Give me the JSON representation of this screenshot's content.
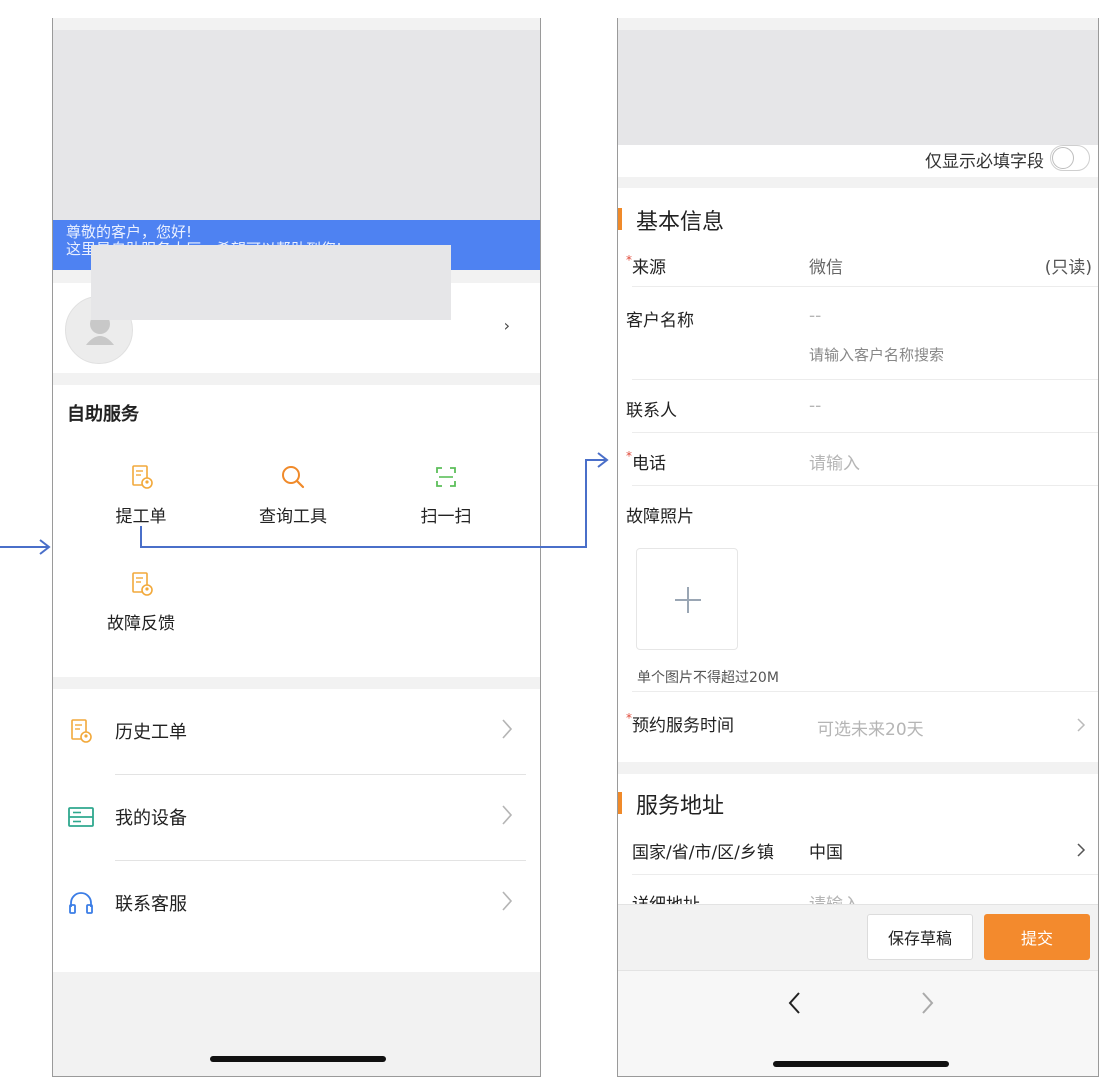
{
  "left_screen": {
    "banner": {
      "greeting": "尊敬的客户，您好!",
      "subtitle": "这里是自助服务大厅，希望可以帮助到您!"
    },
    "profile": {
      "chevron": "›"
    },
    "self_service": {
      "title": "自助服务",
      "items": [
        {
          "label": "提工单",
          "icon": "ticket-icon",
          "color": "#f2a93b"
        },
        {
          "label": "查询工具",
          "icon": "search-icon",
          "color": "#f08a2a"
        },
        {
          "label": "扫一扫",
          "icon": "scan-icon",
          "color": "#5cbf5a"
        },
        {
          "label": "故障反馈",
          "icon": "ticket-icon",
          "color": "#f2a93b"
        }
      ]
    },
    "list": [
      {
        "label": "历史工单",
        "icon": "history-ticket-icon",
        "color": "#f2a93b"
      },
      {
        "label": "我的设备",
        "icon": "device-icon",
        "color": "#2fa88e"
      },
      {
        "label": "联系客服",
        "icon": "headset-icon",
        "color": "#3b7de6"
      }
    ]
  },
  "right_screen": {
    "toggle_label": "仅显示必填字段",
    "basic_info": {
      "title": "基本信息",
      "source": {
        "label": "来源",
        "value": "微信",
        "note": "(只读)"
      },
      "customer_name": {
        "label": "客户名称",
        "value": "--",
        "placeholder": "请输入客户名称搜索"
      },
      "contact": {
        "label": "联系人",
        "value": "--"
      },
      "phone": {
        "label": "电话",
        "placeholder": "请输入"
      },
      "fault_photo": {
        "label": "故障照片",
        "note": "单个图片不得超过20M"
      },
      "appointment": {
        "label": "预约服务时间",
        "placeholder": "可选未来20天"
      }
    },
    "address": {
      "title": "服务地址",
      "region": {
        "label": "国家/省/市/区/乡镇",
        "value": "中国"
      },
      "detail": {
        "label": "详细地址",
        "placeholder": "请输入"
      }
    },
    "actions": {
      "save_draft": "保存草稿",
      "submit": "提交"
    },
    "accent_color": "#f38a2d"
  }
}
